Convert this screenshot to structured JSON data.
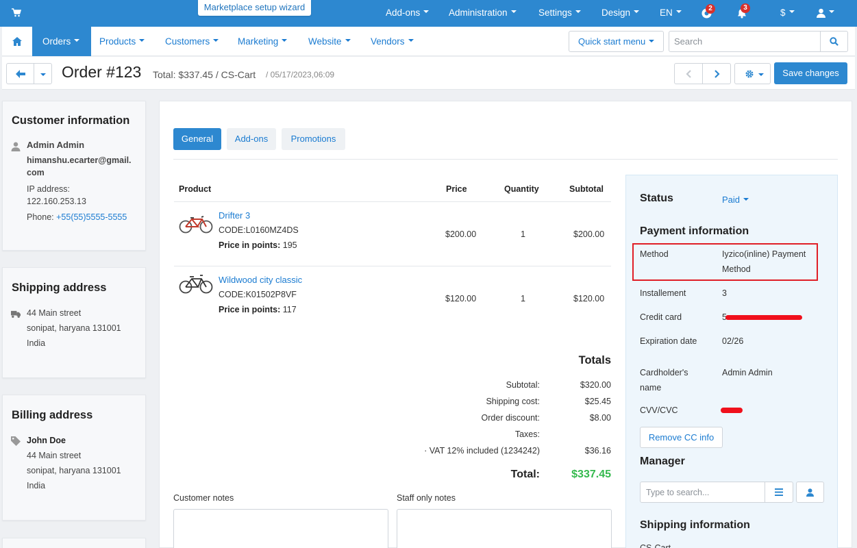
{
  "topbar": {
    "wizard": "Marketplace setup wizard",
    "menu": [
      "Add-ons",
      "Administration",
      "Settings",
      "Design",
      "EN"
    ],
    "help_badge": "2",
    "notif_badge": "3",
    "currency": "$",
    "icons": [
      "cart-icon",
      "help-icon",
      "bell-icon",
      "user-icon"
    ]
  },
  "nav": {
    "items": [
      "Orders",
      "Products",
      "Customers",
      "Marketing",
      "Website",
      "Vendors"
    ],
    "quick_start": "Quick start menu",
    "search_placeholder": "Search"
  },
  "order": {
    "title": "Order #123",
    "subtitle": "Total: $337.45 / CS-Cart",
    "date": "/ 05/17/2023,06:09",
    "save": "Save changes"
  },
  "customer": {
    "heading": "Customer information",
    "name": "Admin Admin",
    "email_1": "himanshu.ecarter@gmail.",
    "email_2": "com",
    "ip_label": "IP address:",
    "ip": "122.160.253.13",
    "phone_label": "Phone:",
    "phone": "+55(55)5555-5555"
  },
  "shipping_address": {
    "heading": "Shipping address",
    "street": "44 Main street",
    "city": "sonipat, haryana 131001",
    "country": "India"
  },
  "billing_address": {
    "heading": "Billing address",
    "name": "John Doe",
    "street": "44 Main street",
    "city": "sonipat, haryana 131001",
    "country": "India"
  },
  "tabs": [
    "General",
    "Add-ons",
    "Promotions"
  ],
  "table": {
    "headers": [
      "Product",
      "Price",
      "Quantity",
      "Subtotal"
    ],
    "points_label": "Price in points:",
    "rows": [
      {
        "name": "Drifter 3",
        "code": "CODE:L0160MZ4DS",
        "points": "195",
        "price": "$200.00",
        "qty": "1",
        "subtotal": "$200.00"
      },
      {
        "name": "Wildwood city classic",
        "code": "CODE:K01502P8VF",
        "points": "117",
        "price": "$120.00",
        "qty": "1",
        "subtotal": "$120.00"
      }
    ]
  },
  "totals": {
    "heading": "Totals",
    "rows": [
      {
        "label": "Subtotal:",
        "value": "$320.00"
      },
      {
        "label": "Shipping cost:",
        "value": "$25.45"
      },
      {
        "label": "Order discount:",
        "value": "$8.00"
      },
      {
        "label": "Taxes:",
        "value": ""
      },
      {
        "label": "· VAT 12% included (1234242)",
        "value": "$36.16"
      }
    ],
    "total_label": "Total:",
    "total_value": "$337.45"
  },
  "notes": {
    "customer": "Customer notes",
    "staff": "Staff only notes"
  },
  "sidebar": {
    "status_heading": "Status",
    "status_value": "Paid",
    "payment_heading": "Payment information",
    "method_label": "Method",
    "method_value_1": "Iyzico(inline) Payment",
    "method_value_2": "Method",
    "installement_label": "Installement",
    "installement_value": "3",
    "card_label": "Credit card",
    "card_value": "5",
    "expiration_label": "Expiration date",
    "expiration_value": "02/26",
    "holder_label_1": "Cardholder's",
    "holder_label_2": "name",
    "holder_value": "Admin Admin",
    "cvv_label": "CVV/CVC",
    "remove_cc": "Remove CC info",
    "manager_heading": "Manager",
    "manager_placeholder": "Type to search...",
    "shipping_heading": "Shipping information",
    "shipping_value": "CS-Cart"
  },
  "colors": {
    "primary": "#2d88d0",
    "link": "#1a7bd1",
    "total_green": "#35b94e",
    "highlight_red": "#e01e26"
  }
}
